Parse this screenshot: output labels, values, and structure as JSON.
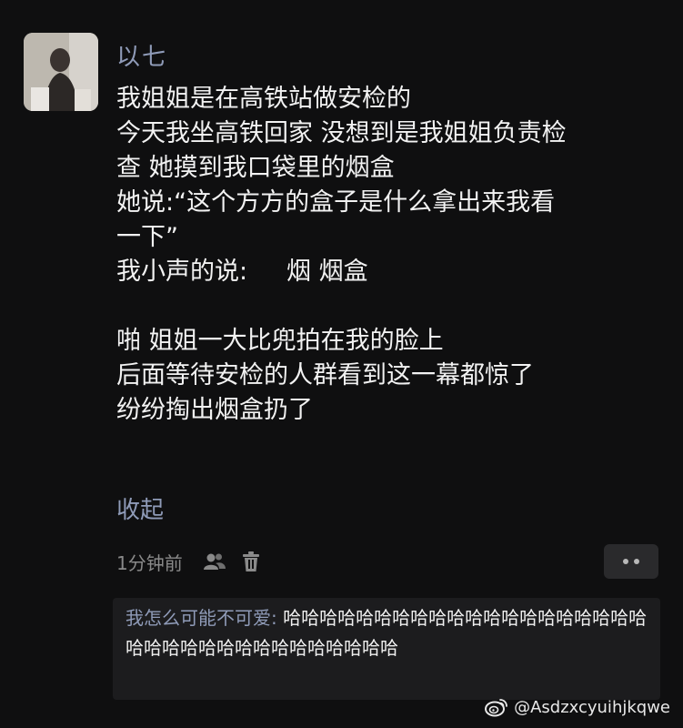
{
  "comment": {
    "username": "以七",
    "lines": [
      "我姐姐是在高铁站做安检的",
      "今天我坐高铁回家 没想到是我姐姐负责检",
      "查 她摸到我口袋里的烟盒",
      "她说:“这个方方的盒子是什么拿出来我看",
      "一下”",
      "我小声的说:     烟 烟盒",
      "",
      "啪 姐姐一大比兜拍在我的脸上",
      "后面等待安检的人群看到这一幕都惊了",
      "纷纷掏出烟盒扔了"
    ],
    "collapse_label": "收起",
    "timestamp": "1分钟前",
    "icons": {
      "user": "users-icon",
      "delete": "trash-icon",
      "more": "more-dots-icon"
    }
  },
  "reply": {
    "username": "我怎么可能不可爱",
    "separator": ": ",
    "text": "哈哈哈哈哈哈哈哈哈哈哈哈哈哈哈哈哈哈哈哈哈哈哈哈哈哈哈哈哈哈哈哈哈哈哈"
  },
  "watermark": {
    "text": "@Asdzxcyuihjkqwe",
    "icon": "weibo-logo-icon"
  },
  "colors": {
    "background": "#0f0f10",
    "link": "#8f9bb8",
    "text": "#f2f2f2",
    "reply_background": "#1c1c1e"
  }
}
